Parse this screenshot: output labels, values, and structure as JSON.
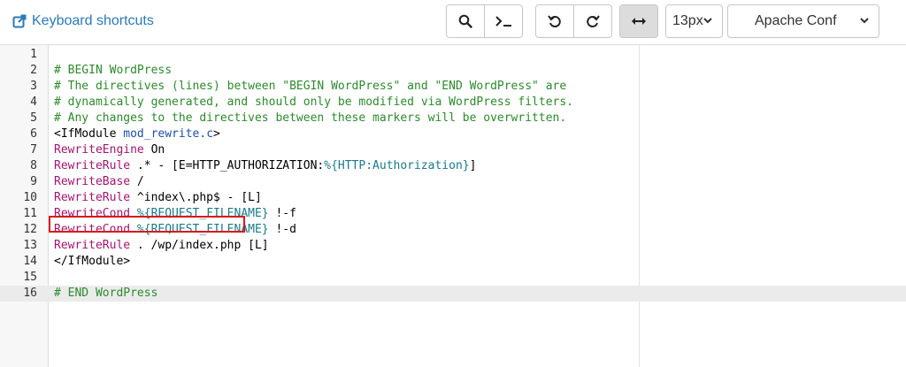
{
  "toolbar": {
    "shortcuts_label": "Keyboard shortcuts",
    "font_size": "13px",
    "mode": "Apache Conf"
  },
  "editor": {
    "lines": [
      {
        "n": "1",
        "tokens": []
      },
      {
        "n": "2",
        "tokens": [
          {
            "t": "# BEGIN WordPress",
            "c": "comment"
          }
        ]
      },
      {
        "n": "3",
        "tokens": [
          {
            "t": "# The directives (lines) between \"BEGIN WordPress\" and \"END WordPress\" are",
            "c": "comment"
          }
        ]
      },
      {
        "n": "4",
        "tokens": [
          {
            "t": "# dynamically generated, and should only be modified via WordPress filters.",
            "c": "comment"
          }
        ]
      },
      {
        "n": "5",
        "tokens": [
          {
            "t": "# Any changes to the directives between these markers will be overwritten.",
            "c": "comment"
          }
        ]
      },
      {
        "n": "6",
        "tokens": [
          {
            "t": "<IfModule ",
            "c": "plain"
          },
          {
            "t": "mod_rewrite.c",
            "c": "def"
          },
          {
            "t": ">",
            "c": "plain"
          }
        ]
      },
      {
        "n": "7",
        "tokens": [
          {
            "t": "RewriteEngine",
            "c": "kw"
          },
          {
            "t": " On",
            "c": "plain"
          }
        ]
      },
      {
        "n": "8",
        "tokens": [
          {
            "t": "RewriteRule",
            "c": "kw"
          },
          {
            "t": " .* - [E=HTTP_AUTHORIZATION:",
            "c": "plain"
          },
          {
            "t": "%{HTTP:Authorization}",
            "c": "var"
          },
          {
            "t": "]",
            "c": "plain"
          }
        ]
      },
      {
        "n": "9",
        "tokens": [
          {
            "t": "RewriteBase",
            "c": "kw"
          },
          {
            "t": " /",
            "c": "plain"
          }
        ]
      },
      {
        "n": "10",
        "tokens": [
          {
            "t": "RewriteRule",
            "c": "kw"
          },
          {
            "t": " ^index\\.php$ - [L]",
            "c": "plain"
          }
        ]
      },
      {
        "n": "11",
        "tokens": [
          {
            "t": "RewriteCond",
            "c": "kw"
          },
          {
            "t": " ",
            "c": "plain"
          },
          {
            "t": "%{REQUEST_FILENAME}",
            "c": "var"
          },
          {
            "t": " !-f",
            "c": "plain"
          }
        ]
      },
      {
        "n": "12",
        "tokens": [
          {
            "t": "RewriteCond",
            "c": "kw"
          },
          {
            "t": " ",
            "c": "plain"
          },
          {
            "t": "%{REQUEST_FILENAME}",
            "c": "var"
          },
          {
            "t": " !-d",
            "c": "plain"
          }
        ]
      },
      {
        "n": "13",
        "tokens": [
          {
            "t": "RewriteRule",
            "c": "kw"
          },
          {
            "t": " . /wp/index.php [L]",
            "c": "plain"
          }
        ]
      },
      {
        "n": "14",
        "tokens": [
          {
            "t": "</IfModule>",
            "c": "plain"
          }
        ]
      },
      {
        "n": "15",
        "tokens": []
      },
      {
        "n": "16",
        "tokens": [
          {
            "t": "# END WordPress",
            "c": "comment"
          }
        ]
      }
    ],
    "active_line": "16",
    "highlighted_line": "9"
  },
  "icons": {
    "shortcuts": "external-link-icon",
    "search": "search-icon",
    "goto": "terminal-icon",
    "undo": "undo-icon",
    "redo": "redo-icon",
    "wrap": "arrows-horizontal-icon",
    "dropdown": "chevron-down-icon"
  },
  "colors": {
    "link": "#2a7ab8",
    "comment": "#2c8a2c",
    "keyword": "#a3156f",
    "definition": "#1d4ea8",
    "variable": "#1a7a8a",
    "highlight_border": "#d9191c"
  }
}
